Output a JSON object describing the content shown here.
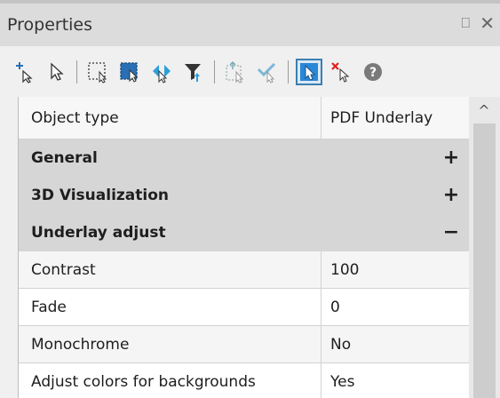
{
  "panel": {
    "title": "Properties",
    "pin_glyph": "⎕",
    "close_glyph": "✕"
  },
  "toolbar": {
    "buttons": [
      {
        "icon": "add-to-selection-icon"
      },
      {
        "icon": "select-arrow-icon"
      },
      {
        "icon": "select-window-icon"
      },
      {
        "icon": "select-all-icon"
      },
      {
        "icon": "select-similar-icon"
      },
      {
        "icon": "filter-select-icon"
      },
      {
        "icon": "quick-select-icon"
      },
      {
        "icon": "select-checked-icon"
      },
      {
        "icon": "select-objects-icon",
        "active": true
      },
      {
        "icon": "remove-from-selection-icon"
      },
      {
        "icon": "help-icon",
        "glyph": "?"
      }
    ]
  },
  "object_type": {
    "label": "Object type",
    "value": "PDF Underlay"
  },
  "categories": [
    {
      "label": "General",
      "sign": "+"
    },
    {
      "label": "3D Visualization",
      "sign": "+"
    },
    {
      "label": "Underlay adjust",
      "sign": "−"
    }
  ],
  "properties": [
    {
      "label": "Contrast",
      "value": "100"
    },
    {
      "label": "Fade",
      "value": "0"
    },
    {
      "label": "Monochrome",
      "value": "No"
    },
    {
      "label": "Adjust colors for backgrounds",
      "value": "Yes"
    }
  ],
  "scrollbar": {
    "up_glyph": "^"
  },
  "colors": {
    "accent": "#3c7fb1",
    "category_bg": "#d6d6d6",
    "remove": "#e02020"
  }
}
